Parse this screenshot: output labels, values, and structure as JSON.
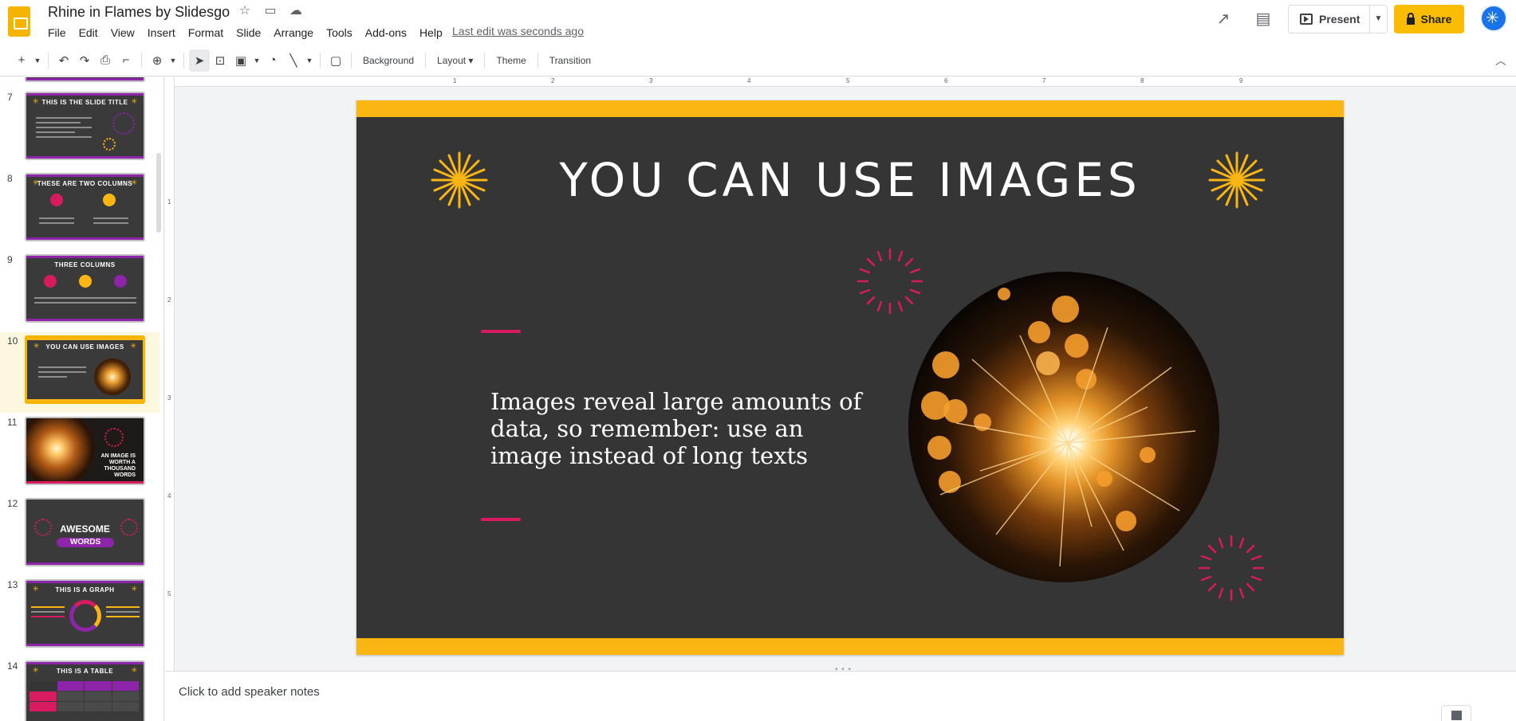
{
  "doc": {
    "title": "Rhine in Flames by Slidesgo",
    "last_edit": "Last edit was seconds ago"
  },
  "menu": [
    "File",
    "Edit",
    "View",
    "Insert",
    "Format",
    "Slide",
    "Arrange",
    "Tools",
    "Add-ons",
    "Help"
  ],
  "header": {
    "present_label": "Present",
    "share_label": "Share"
  },
  "toolbar": {
    "background_label": "Background",
    "layout_label": "Layout",
    "theme_label": "Theme",
    "transition_label": "Transition"
  },
  "ruler": {
    "horizontal": [
      "1",
      "2",
      "3",
      "4",
      "5",
      "6",
      "7",
      "8",
      "9"
    ],
    "vertical": [
      "1",
      "2",
      "3",
      "4",
      "5"
    ]
  },
  "filmstrip": [
    {
      "num": "7",
      "title": "THIS IS THE SLIDE TITLE"
    },
    {
      "num": "8",
      "title": "THESE ARE TWO COLUMNS"
    },
    {
      "num": "9",
      "title": "THREE COLUMNS"
    },
    {
      "num": "10",
      "title": "YOU CAN USE IMAGES"
    },
    {
      "num": "11",
      "title": "AN IMAGE IS WORTH A THOUSAND WORDS"
    },
    {
      "num": "12",
      "title": "AWESOME",
      "subtitle": "WORDS"
    },
    {
      "num": "13",
      "title": "THIS IS A GRAPH"
    },
    {
      "num": "14",
      "title": "THIS IS A TABLE"
    }
  ],
  "slide": {
    "title": "YOU CAN USE IMAGES",
    "body": "Images reveal large amounts of data, so remember: use an image instead of long texts"
  },
  "notes": {
    "placeholder": "Click to add speaker notes"
  },
  "colors": {
    "accent_yellow": "#fbb614",
    "accent_pink": "#d81b60",
    "accent_purple": "#8e24aa",
    "slide_bg": "#353535",
    "share_bg": "#fbbc04"
  },
  "icons": {
    "app_logo": "slides-logo-icon",
    "star": "star-icon",
    "move": "folder-move-icon",
    "cloud": "cloud-status-icon",
    "activity": "activity-trend-icon",
    "comments": "comments-icon",
    "present": "present-play-icon",
    "lock": "lock-icon",
    "avatar": "account-avatar-icon"
  }
}
